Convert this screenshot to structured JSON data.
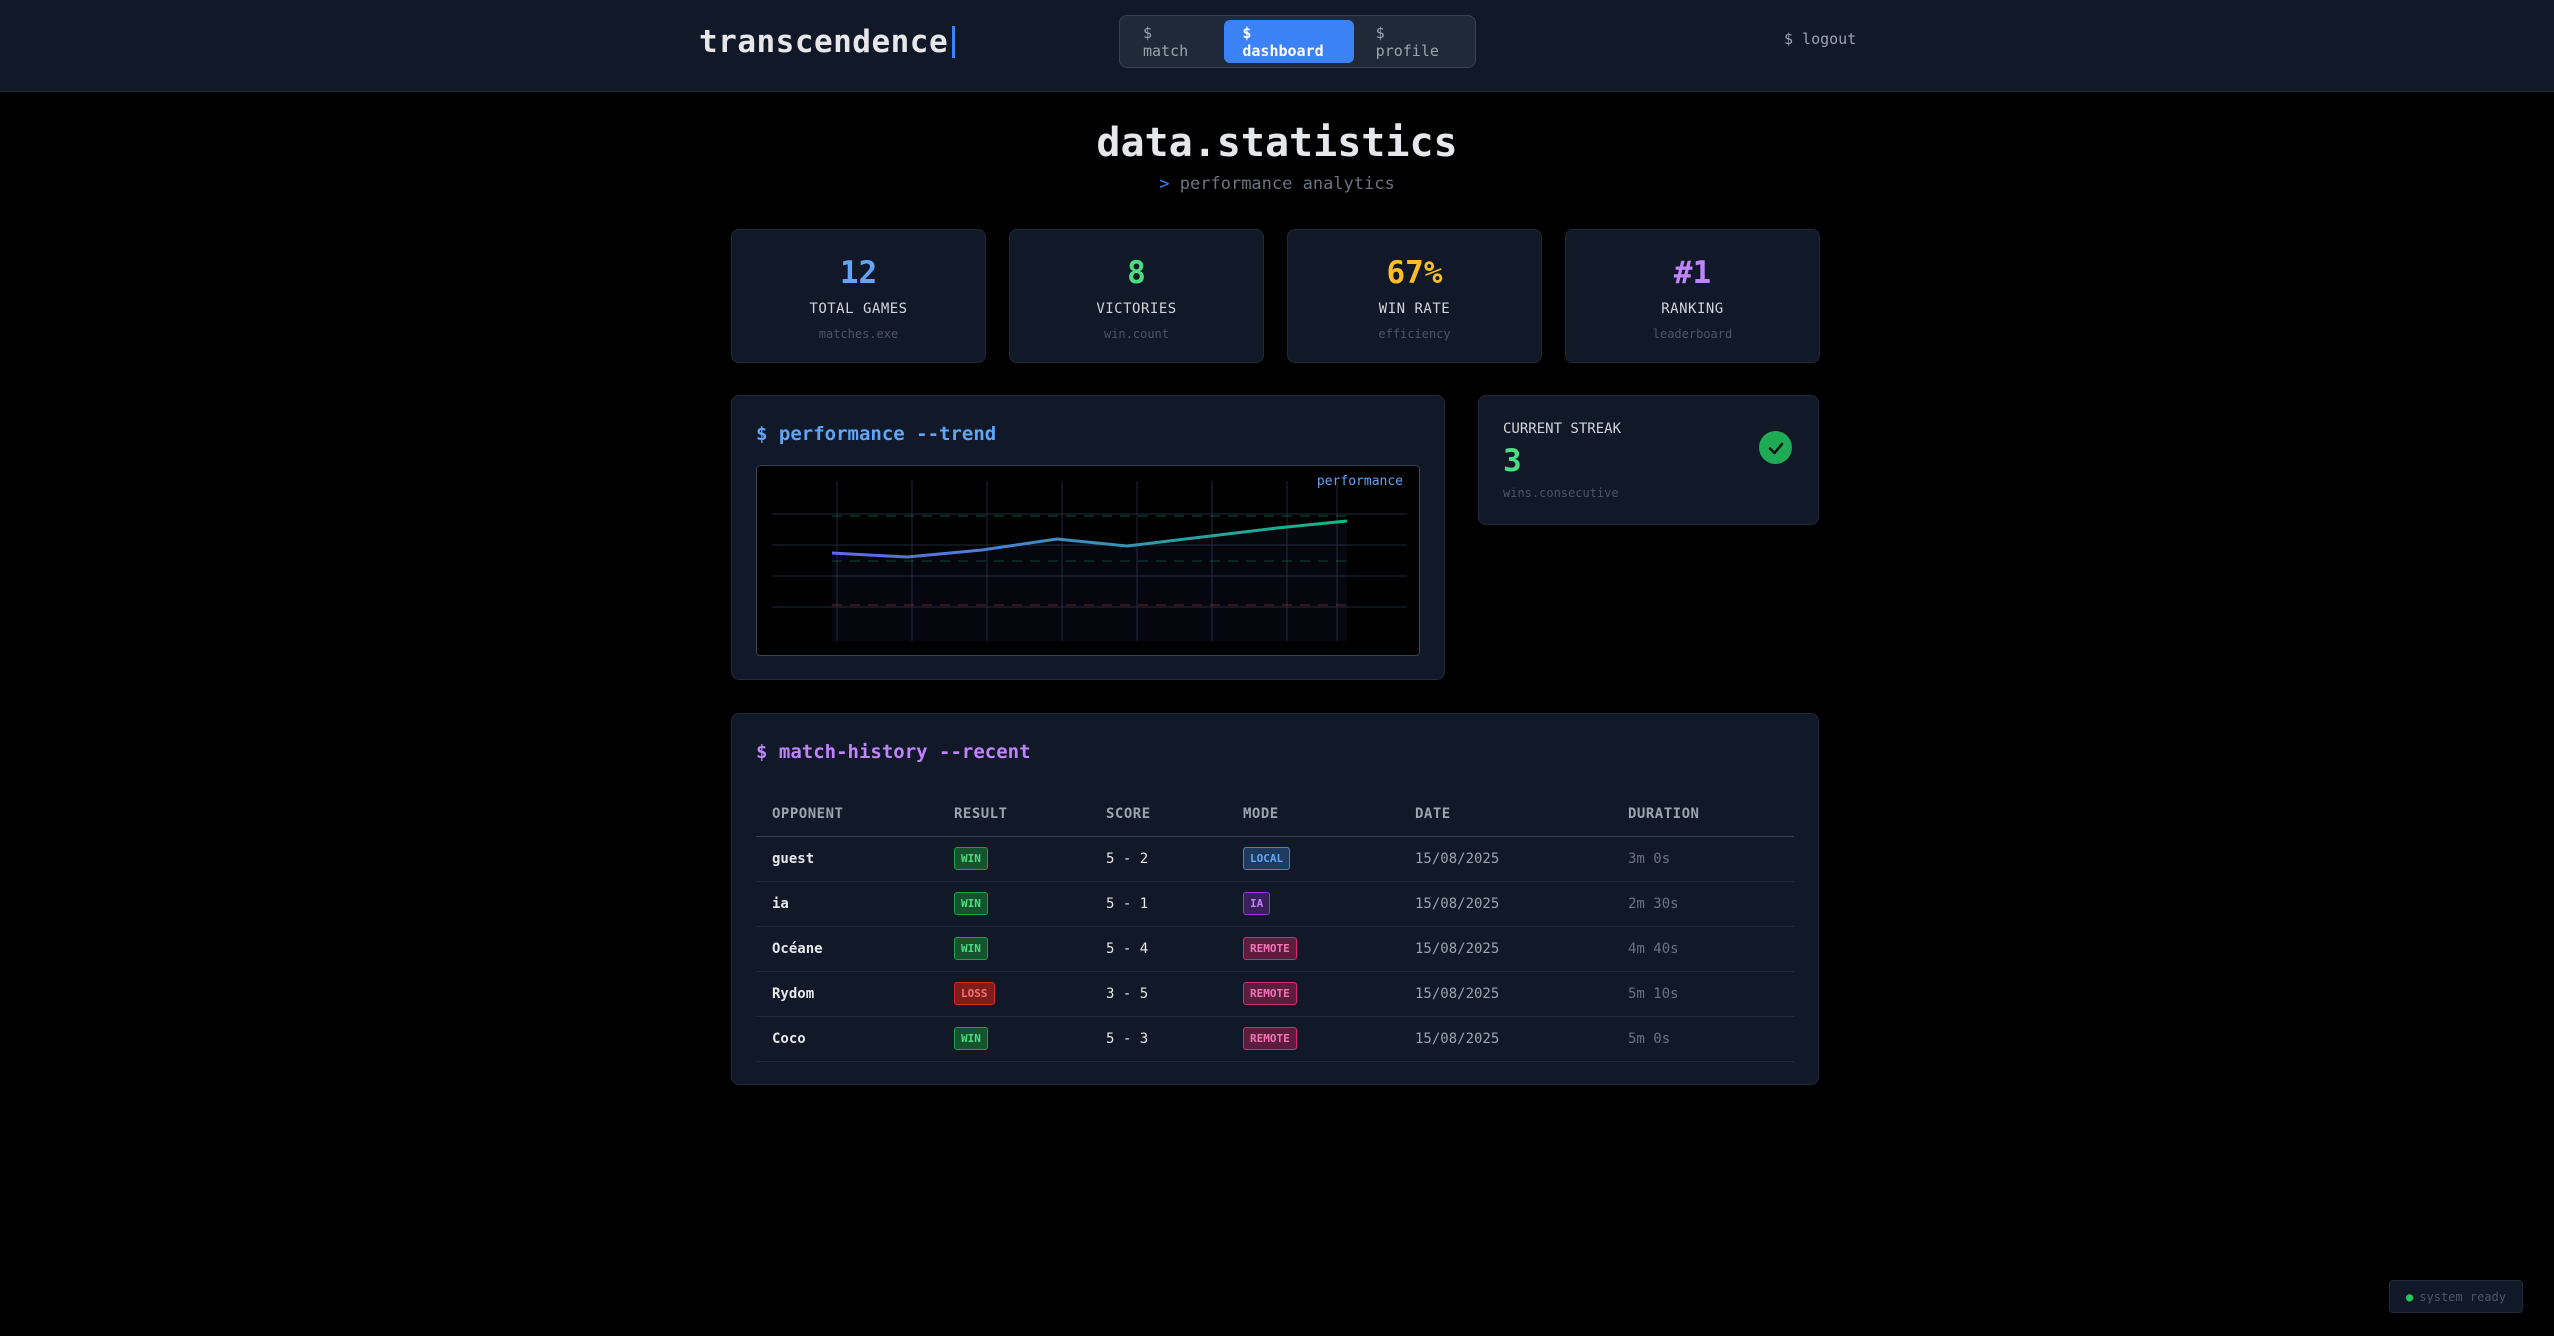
{
  "header": {
    "brand": "transcendence",
    "nav": [
      {
        "label": "$ match",
        "active": false
      },
      {
        "label": "$ dashboard",
        "active": true
      },
      {
        "label": "$ profile",
        "active": false
      }
    ],
    "logout": "$ logout"
  },
  "page": {
    "title": "data.statistics",
    "subtitle_prompt": ">",
    "subtitle": "performance analytics"
  },
  "stats": [
    {
      "value": "12",
      "label": "TOTAL GAMES",
      "sub": "matches.exe",
      "color": "#60a5fa"
    },
    {
      "value": "8",
      "label": "VICTORIES",
      "sub": "win.count",
      "color": "#4ade80"
    },
    {
      "value": "67%",
      "label": "WIN RATE",
      "sub": "efficiency",
      "color": "#fbbf24"
    },
    {
      "value": "#1",
      "label": "RANKING",
      "sub": "leaderboard",
      "color": "#c084fc"
    }
  ],
  "performance": {
    "title": "$ performance --trend",
    "title_color": "#60a5fa",
    "legend": "performance",
    "line_color_start": "#6366f1",
    "line_color_end": "#10b981"
  },
  "streak": {
    "label": "CURRENT STREAK",
    "value": "3",
    "sub": "wins.consecutive",
    "icon": "check-circle-icon"
  },
  "history": {
    "title": "$ match-history --recent",
    "title_color": "#c084fc",
    "columns": [
      "OPPONENT",
      "RESULT",
      "SCORE",
      "MODE",
      "DATE",
      "DURATION"
    ],
    "rows": [
      {
        "opponent": "guest",
        "result": "WIN",
        "score": "5 - 2",
        "mode": "LOCAL",
        "date": "15/08/2025",
        "duration": "3m 0s"
      },
      {
        "opponent": "ia",
        "result": "WIN",
        "score": "5 - 1",
        "mode": "IA",
        "date": "15/08/2025",
        "duration": "2m 30s"
      },
      {
        "opponent": "Océane",
        "result": "WIN",
        "score": "5 - 4",
        "mode": "REMOTE",
        "date": "15/08/2025",
        "duration": "4m 40s"
      },
      {
        "opponent": "Rydom",
        "result": "LOSS",
        "score": "3 - 5",
        "mode": "REMOTE",
        "date": "15/08/2025",
        "duration": "5m 10s"
      },
      {
        "opponent": "Coco",
        "result": "WIN",
        "score": "5 - 3",
        "mode": "REMOTE",
        "date": "15/08/2025",
        "duration": "5m 0s"
      }
    ]
  },
  "system": {
    "dot": "●",
    "status": "system ready"
  }
}
